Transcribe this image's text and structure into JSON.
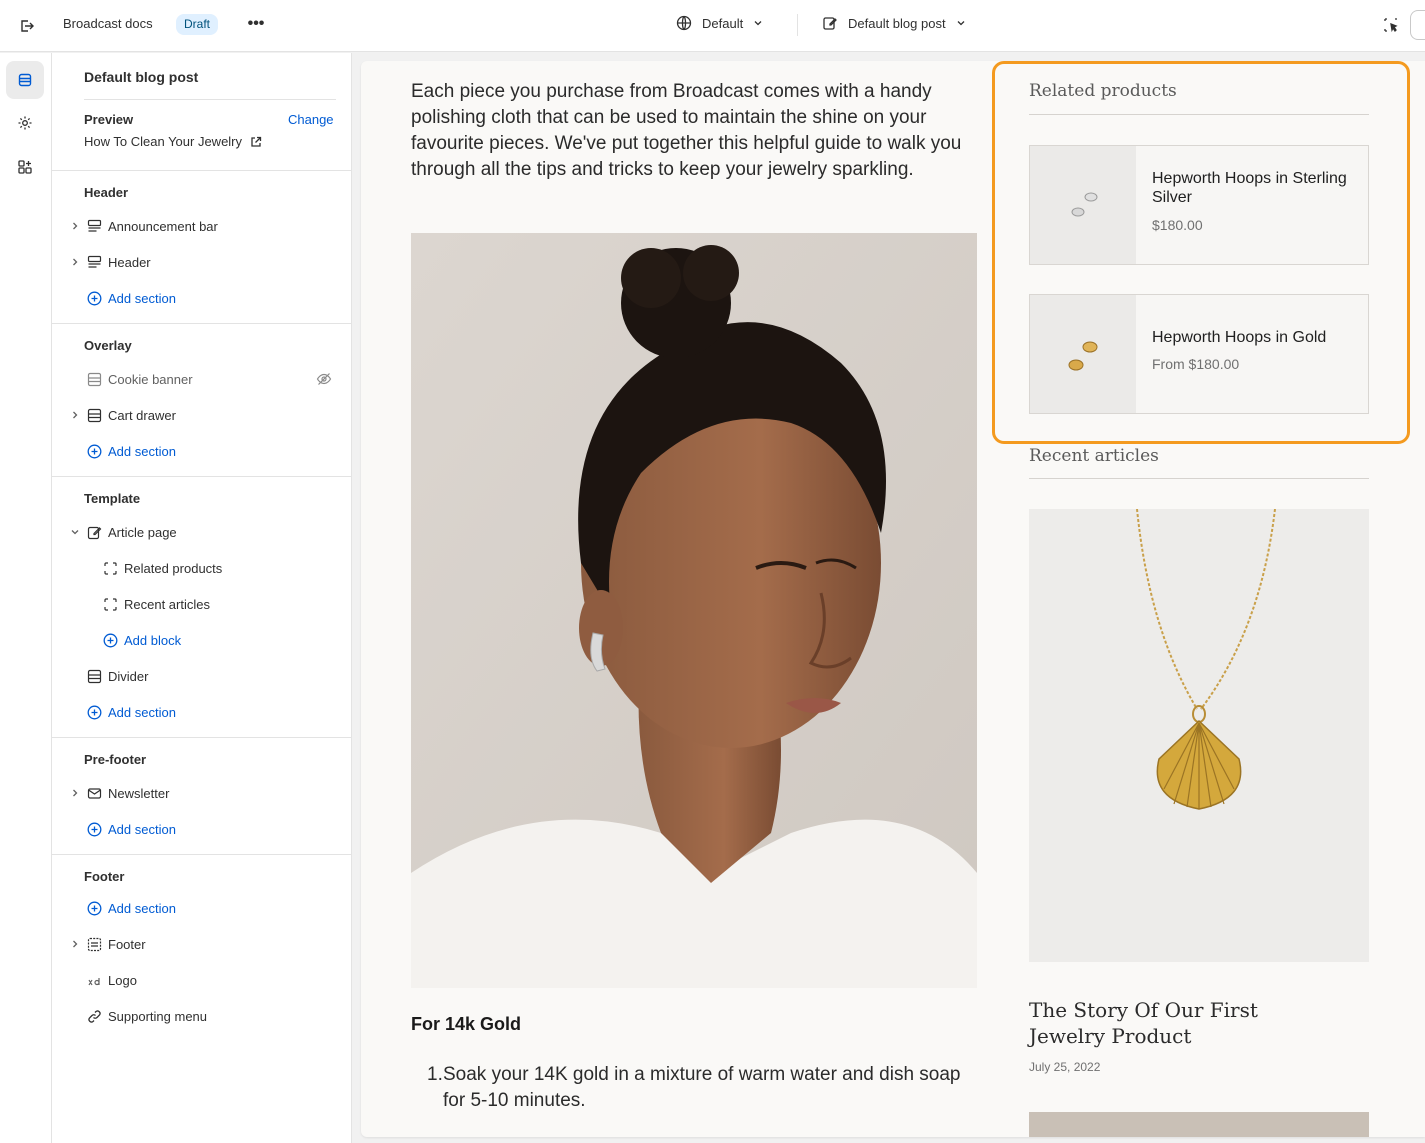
{
  "topbar": {
    "store_title": "Broadcast docs",
    "status_badge": "Draft",
    "more_label": "•••",
    "theme_selector": "Default",
    "template_selector": "Default blog post"
  },
  "sidebar": {
    "title": "Default blog post",
    "preview_label": "Preview",
    "change_label": "Change",
    "preview_value": "How To Clean Your Jewelry",
    "groups": {
      "header": {
        "label": "Header",
        "items": [
          "Announcement bar",
          "Header"
        ],
        "add": "Add section"
      },
      "overlay": {
        "label": "Overlay",
        "items": [
          "Cookie banner",
          "Cart drawer"
        ],
        "add": "Add section"
      },
      "template": {
        "label": "Template",
        "article_page": "Article page",
        "blocks": [
          "Related products",
          "Recent articles"
        ],
        "add_block": "Add block",
        "divider": "Divider",
        "add": "Add section"
      },
      "prefooter": {
        "label": "Pre-footer",
        "items": [
          "Newsletter"
        ],
        "add": "Add section"
      },
      "footer": {
        "label": "Footer",
        "add": "Add section",
        "items": [
          "Footer",
          "Logo",
          "Supporting menu"
        ]
      }
    }
  },
  "preview": {
    "intro": "Each piece you purchase from Broadcast comes with a handy polishing cloth that can be used to maintain the shine on your favourite pieces. We've put together this helpful guide to walk you through all the tips and tricks to keep your jewelry sparkling.",
    "subheading": "For 14k Gold",
    "list": [
      {
        "num": "1.",
        "text": "Soak your 14K gold in a mixture of warm water and dish soap for 5-10 minutes."
      }
    ],
    "related_title": "Related products",
    "products": [
      {
        "name": "Hepworth Hoops in Sterling Silver",
        "price": "$180.00"
      },
      {
        "name": "Hepworth Hoops in Gold",
        "price": "From $180.00"
      }
    ],
    "recent_title": "Recent articles",
    "article": {
      "title": "The Story Of Our First Jewelry Product",
      "date": "July 25, 2022"
    }
  },
  "colors": {
    "accent_link": "#005bd3",
    "highlight": "#f49a1f",
    "badge_bg": "#e0f0ff"
  }
}
